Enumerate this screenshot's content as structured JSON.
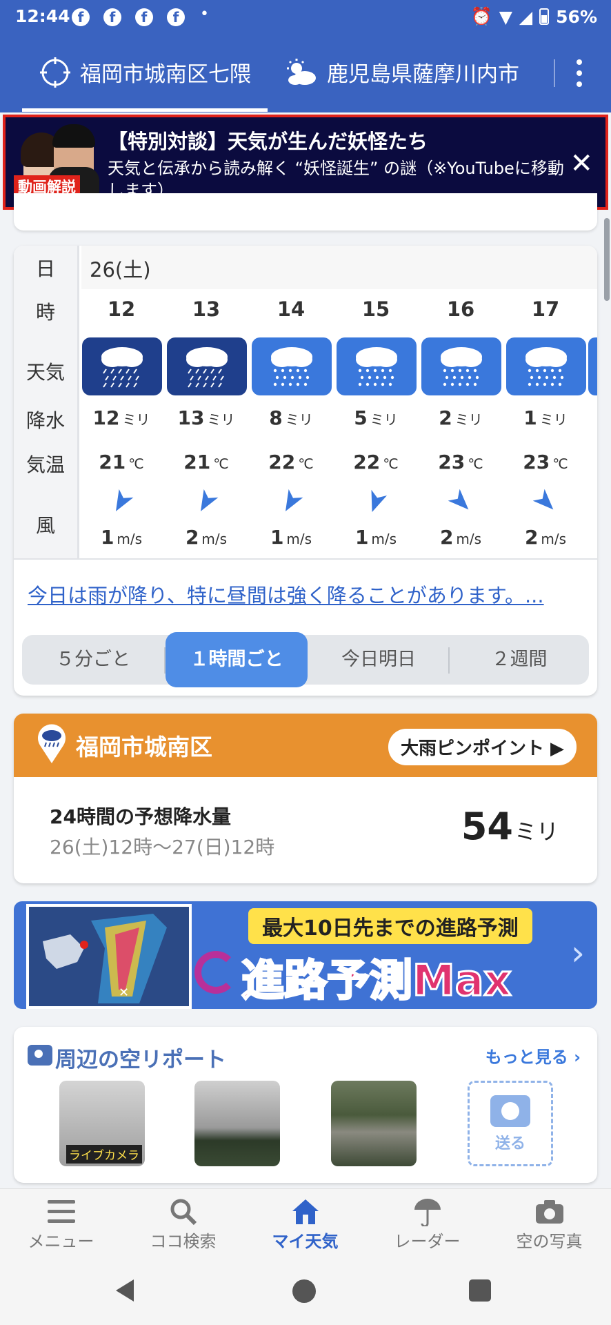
{
  "status_bar": {
    "time": "12:44",
    "app_icons": [
      "facebook-icon",
      "facebook-icon",
      "facebook-icon",
      "facebook-icon"
    ],
    "dot": "•",
    "battery": "56%"
  },
  "tabs": [
    {
      "label": "福岡市城南区七隈",
      "icon": "location-target-icon",
      "active": true
    },
    {
      "label": "鹿児島県薩摩川内市",
      "icon": "sun-cloud-icon",
      "active": false
    }
  ],
  "banner": {
    "tag": "動画解説",
    "title": "【特別対談】天気が生んだ妖怪たち",
    "subtitle": "天気と伝承から読み解く “妖怪誕生” の謎（※YouTubeに移動します）",
    "close": "✕"
  },
  "hourly": {
    "row_labels": {
      "day": "日",
      "hour": "時",
      "weather": "天気",
      "precip": "降水",
      "temp": "気温",
      "wind": "風"
    },
    "date": "26(土)",
    "precip_unit": "ミリ",
    "temp_unit": "℃",
    "wind_unit": "m/s",
    "hours": [
      {
        "hour": "12",
        "weather": "heavy-rain",
        "precip": "12",
        "temp": "21",
        "wind_speed": "1",
        "wind_dir": "southwest"
      },
      {
        "hour": "13",
        "weather": "heavy-rain",
        "precip": "13",
        "temp": "21",
        "wind_speed": "2",
        "wind_dir": "southwest"
      },
      {
        "hour": "14",
        "weather": "rain",
        "precip": "8",
        "temp": "22",
        "wind_speed": "1",
        "wind_dir": "southwest"
      },
      {
        "hour": "15",
        "weather": "rain",
        "precip": "5",
        "temp": "22",
        "wind_speed": "1",
        "wind_dir": "east"
      },
      {
        "hour": "16",
        "weather": "rain",
        "precip": "2",
        "temp": "23",
        "wind_speed": "2",
        "wind_dir": "southeast"
      },
      {
        "hour": "17",
        "weather": "rain",
        "precip": "1",
        "temp": "23",
        "wind_speed": "2",
        "wind_dir": "southeast"
      }
    ],
    "summary": "今日は雨が降り、特に昼間は強く降ることがあります。...",
    "segments": [
      "５分ごと",
      "１時間ごと",
      "今日明日",
      "２週間"
    ],
    "active_segment": "１時間ごと"
  },
  "rain_pinpoint": {
    "place": "福岡市城南区",
    "button": "大雨ピンポイント ▶",
    "label": "24時間の予想降水量",
    "period": "26(土)12時〜27(日)12時",
    "amount": "54",
    "unit": "ミリ"
  },
  "typhoon": {
    "tag": "最大10日先までの進路予測",
    "title": "進路予測Max"
  },
  "sky_report": {
    "title": "周辺の空リポート",
    "more": "もっと見る",
    "thumbs": [
      {
        "caption": "ライブカメラ"
      },
      {
        "caption": ""
      },
      {
        "caption": ""
      }
    ],
    "send": "送る"
  },
  "bottom_nav": [
    {
      "label": "メニュー",
      "icon": "menu-icon"
    },
    {
      "label": "ココ検索",
      "icon": "search-icon"
    },
    {
      "label": "マイ天気",
      "icon": "home-icon",
      "active": true
    },
    {
      "label": "レーダー",
      "icon": "radar-umbrella-icon"
    },
    {
      "label": "空の写真",
      "icon": "camera-icon"
    }
  ],
  "colors": {
    "header": "#3a63c0",
    "heavy_rain": "#1f3f8c",
    "rain": "#3a78dc",
    "orange": "#e8912f",
    "link": "#2f62c9"
  }
}
